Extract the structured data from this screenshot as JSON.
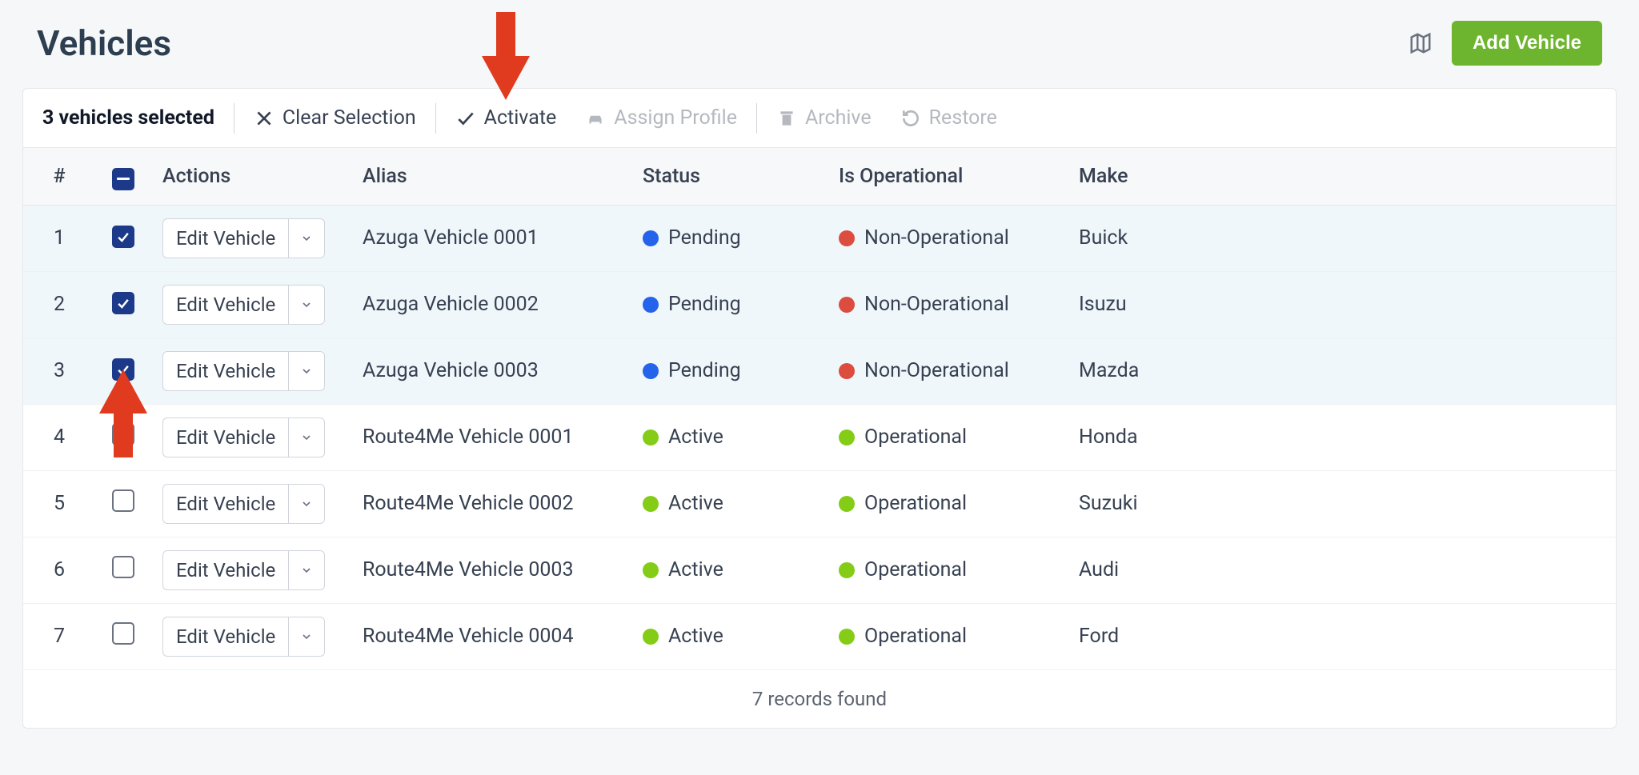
{
  "page": {
    "title": "Vehicles",
    "add_button": "Add Vehicle"
  },
  "toolbar": {
    "selection_text": "3 vehicles selected",
    "clear_selection": "Clear Selection",
    "activate": "Activate",
    "assign_profile": "Assign Profile",
    "archive": "Archive",
    "restore": "Restore"
  },
  "columns": {
    "num": "#",
    "actions": "Actions",
    "alias": "Alias",
    "status": "Status",
    "operational": "Is Operational",
    "make": "Make"
  },
  "edit_button_label": "Edit Vehicle",
  "rows": [
    {
      "num": "1",
      "selected": true,
      "alias": "Azuga Vehicle 0001",
      "status": "Pending",
      "status_color": "blue",
      "op": "Non-Operational",
      "op_color": "red",
      "make": "Buick"
    },
    {
      "num": "2",
      "selected": true,
      "alias": "Azuga Vehicle 0002",
      "status": "Pending",
      "status_color": "blue",
      "op": "Non-Operational",
      "op_color": "red",
      "make": "Isuzu"
    },
    {
      "num": "3",
      "selected": true,
      "alias": "Azuga Vehicle 0003",
      "status": "Pending",
      "status_color": "blue",
      "op": "Non-Operational",
      "op_color": "red",
      "make": "Mazda"
    },
    {
      "num": "4",
      "selected": false,
      "alias": "Route4Me Vehicle 0001",
      "status": "Active",
      "status_color": "green",
      "op": "Operational",
      "op_color": "green",
      "make": "Honda"
    },
    {
      "num": "5",
      "selected": false,
      "alias": "Route4Me Vehicle 0002",
      "status": "Active",
      "status_color": "green",
      "op": "Operational",
      "op_color": "green",
      "make": "Suzuki"
    },
    {
      "num": "6",
      "selected": false,
      "alias": "Route4Me Vehicle 0003",
      "status": "Active",
      "status_color": "green",
      "op": "Operational",
      "op_color": "green",
      "make": "Audi"
    },
    {
      "num": "7",
      "selected": false,
      "alias": "Route4Me Vehicle 0004",
      "status": "Active",
      "status_color": "green",
      "op": "Operational",
      "op_color": "green",
      "make": "Ford"
    }
  ],
  "footer": {
    "records_text": "7 records found"
  },
  "annotations": {
    "arrow_down_target": "activate",
    "arrow_up_target": "row-3-checkbox"
  }
}
